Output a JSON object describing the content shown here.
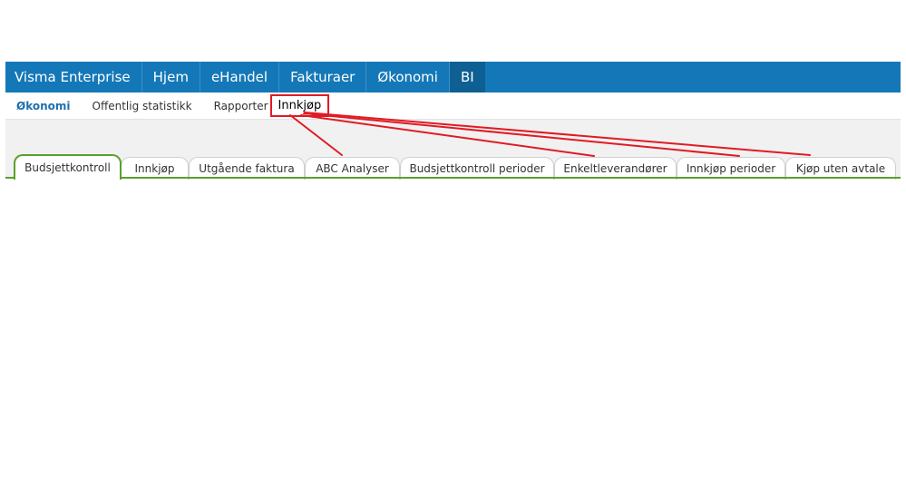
{
  "topbar": {
    "brand": "Visma Enterprise",
    "items": [
      {
        "label": "Hjem"
      },
      {
        "label": "eHandel"
      },
      {
        "label": "Fakturaer"
      },
      {
        "label": "Økonomi"
      },
      {
        "label": "BI"
      }
    ],
    "active": "BI",
    "color": "#1478b8"
  },
  "subnav": {
    "items": [
      {
        "label": "Økonomi"
      },
      {
        "label": "Offentlig statistikk"
      },
      {
        "label": "Rapporter"
      },
      {
        "label": "Innkjøp"
      }
    ],
    "active": "Økonomi",
    "highlighted": "Innkjøp"
  },
  "tabs": {
    "items": [
      {
        "label": "Budsjettkontroll"
      },
      {
        "label": "Innkjøp"
      },
      {
        "label": "Utgående faktura"
      },
      {
        "label": "ABC Analyser"
      },
      {
        "label": "Budsjettkontroll perioder"
      },
      {
        "label": "Enkeltleverandører"
      },
      {
        "label": "Innkjøp perioder"
      },
      {
        "label": "Kjøp uten avtale"
      }
    ],
    "active": "Budsjettkontroll",
    "accent": "#5aa02c"
  },
  "annotation": {
    "color": "#e01b24",
    "icon": "red-arrows"
  }
}
